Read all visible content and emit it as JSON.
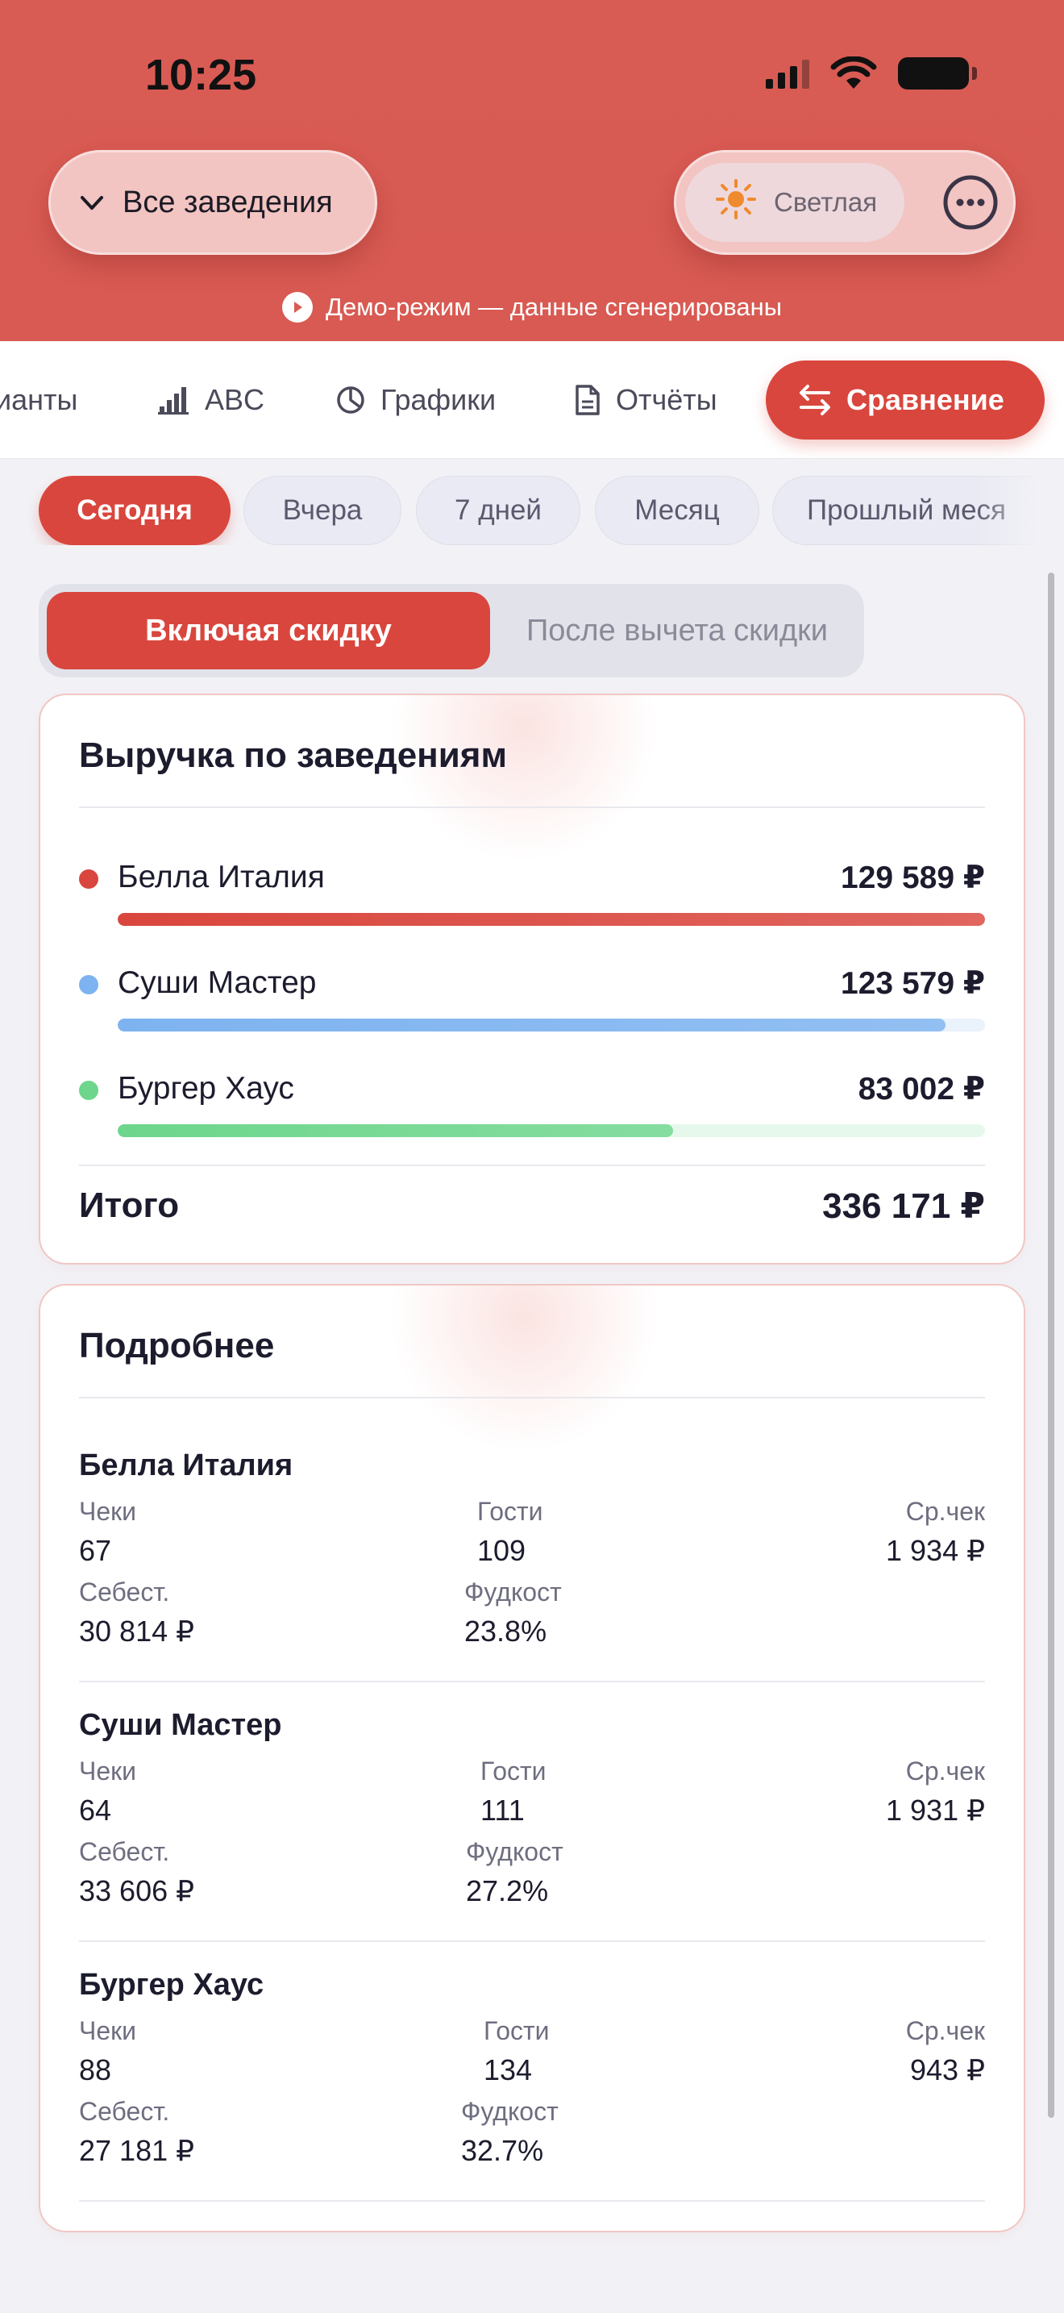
{
  "status_bar": {
    "time": "10:25"
  },
  "header": {
    "venues_selector": "Все заведения",
    "theme_label": "Светлая",
    "demo_notice": "Демо-режим — данные сгенерированы",
    "accent_color": "#d9463d"
  },
  "tabs": [
    {
      "label": "ианты",
      "icon": ""
    },
    {
      "label": "ABC",
      "icon": "bars-icon"
    },
    {
      "label": "Графики",
      "icon": "pie-icon"
    },
    {
      "label": "Отчёты",
      "icon": "document-icon"
    },
    {
      "label": "Сравнение",
      "icon": "swap-icon",
      "active": true
    }
  ],
  "periods": [
    {
      "label": "Сегодня",
      "active": true
    },
    {
      "label": "Вчера"
    },
    {
      "label": "7 дней"
    },
    {
      "label": "Месяц"
    },
    {
      "label": "Прошлый меся"
    }
  ],
  "discount_toggle": {
    "options": [
      "Включая скидку",
      "После вычета скидки"
    ],
    "selected": "Включая скидку"
  },
  "revenue_card": {
    "title": "Выручка по заведениям",
    "rows": [
      {
        "name": "Белла Италия",
        "value": "129 589 ₽",
        "share": 1.0,
        "color": "#d9463d",
        "track": "#fbe6e5"
      },
      {
        "name": "Суши Мастер",
        "value": "123 579 ₽",
        "share": 0.954,
        "color": "#7db3f0",
        "track": "#eaf2fc"
      },
      {
        "name": "Бургер Хаус",
        "value": "83 002 ₽",
        "share": 0.64,
        "color": "#6dd68c",
        "track": "#e6f8ec"
      }
    ],
    "total_label": "Итого",
    "total_value": "336 171 ₽"
  },
  "details_card": {
    "title": "Подробнее",
    "labels": {
      "checks": "Чеки",
      "guests": "Гости",
      "avg": "Ср.чек",
      "cost": "Себест.",
      "foodcost": "Фудкост"
    },
    "venues": [
      {
        "name": "Белла Италия",
        "checks": "67",
        "guests": "109",
        "avg": "1 934 ₽",
        "cost": "30 814 ₽",
        "foodcost": "23.8%"
      },
      {
        "name": "Суши Мастер",
        "checks": "64",
        "guests": "111",
        "avg": "1 931 ₽",
        "cost": "33 606 ₽",
        "foodcost": "27.2%"
      },
      {
        "name": "Бургер Хаус",
        "checks": "88",
        "guests": "134",
        "avg": "943 ₽",
        "cost": "27 181 ₽",
        "foodcost": "32.7%"
      }
    ]
  }
}
